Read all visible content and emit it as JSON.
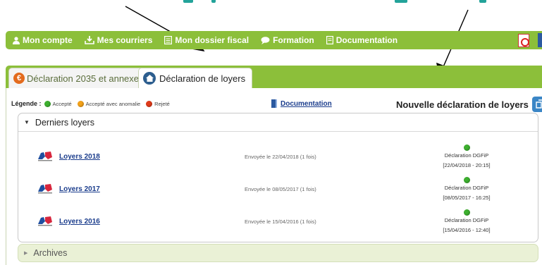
{
  "nav": {
    "items": [
      {
        "label": "Mon compte",
        "icon": "user-icon"
      },
      {
        "label": "Mes courriers",
        "icon": "download-icon"
      },
      {
        "label": "Mon dossier fiscal",
        "icon": "folder-icon"
      },
      {
        "label": "Formation",
        "icon": "speech-bubble-icon"
      },
      {
        "label": "Documentation",
        "icon": "document-icon"
      }
    ],
    "right_icons": [
      "pdf-icon",
      "blue-book-icon"
    ]
  },
  "tabs": [
    {
      "label": "Déclaration 2035 et annexes",
      "icon": "euro-icon",
      "active": false
    },
    {
      "label": "Déclaration de loyers",
      "icon": "house-icon",
      "active": true
    }
  ],
  "legend": {
    "title": "Légende :",
    "items": [
      {
        "label": "Accepté",
        "color": "#3db02f"
      },
      {
        "label": "Accepté avec anomalie",
        "color": "#f4a21a"
      },
      {
        "label": "Rejeté",
        "color": "#e03a1a"
      }
    ]
  },
  "documentation_link": "Documentation",
  "new_declaration": "Nouvelle déclaration de loyers",
  "recent_panel": {
    "title": "Derniers loyers",
    "rows": [
      {
        "title": "Loyers 2018",
        "sent": "Envoyée le 22/04/2018 (1 fois)",
        "status": "Déclaration DGFiP",
        "timestamp": "[22/04/2018 - 20:15]"
      },
      {
        "title": "Loyers 2017",
        "sent": "Envoyée le 08/05/2017 (1 fois)",
        "status": "Déclaration DGFiP",
        "timestamp": "[08/05/2017 - 16:25]"
      },
      {
        "title": "Loyers 2016",
        "sent": "Envoyée le 15/04/2016 (1 fois)",
        "status": "Déclaration DGFiP",
        "timestamp": "[15/04/2016 - 12:40]"
      }
    ]
  },
  "archives_panel": {
    "title": "Archives"
  },
  "colors": {
    "nav_green": "#8cbf3a",
    "link_blue": "#1a3c8c",
    "accepted_green": "#3db02f"
  }
}
